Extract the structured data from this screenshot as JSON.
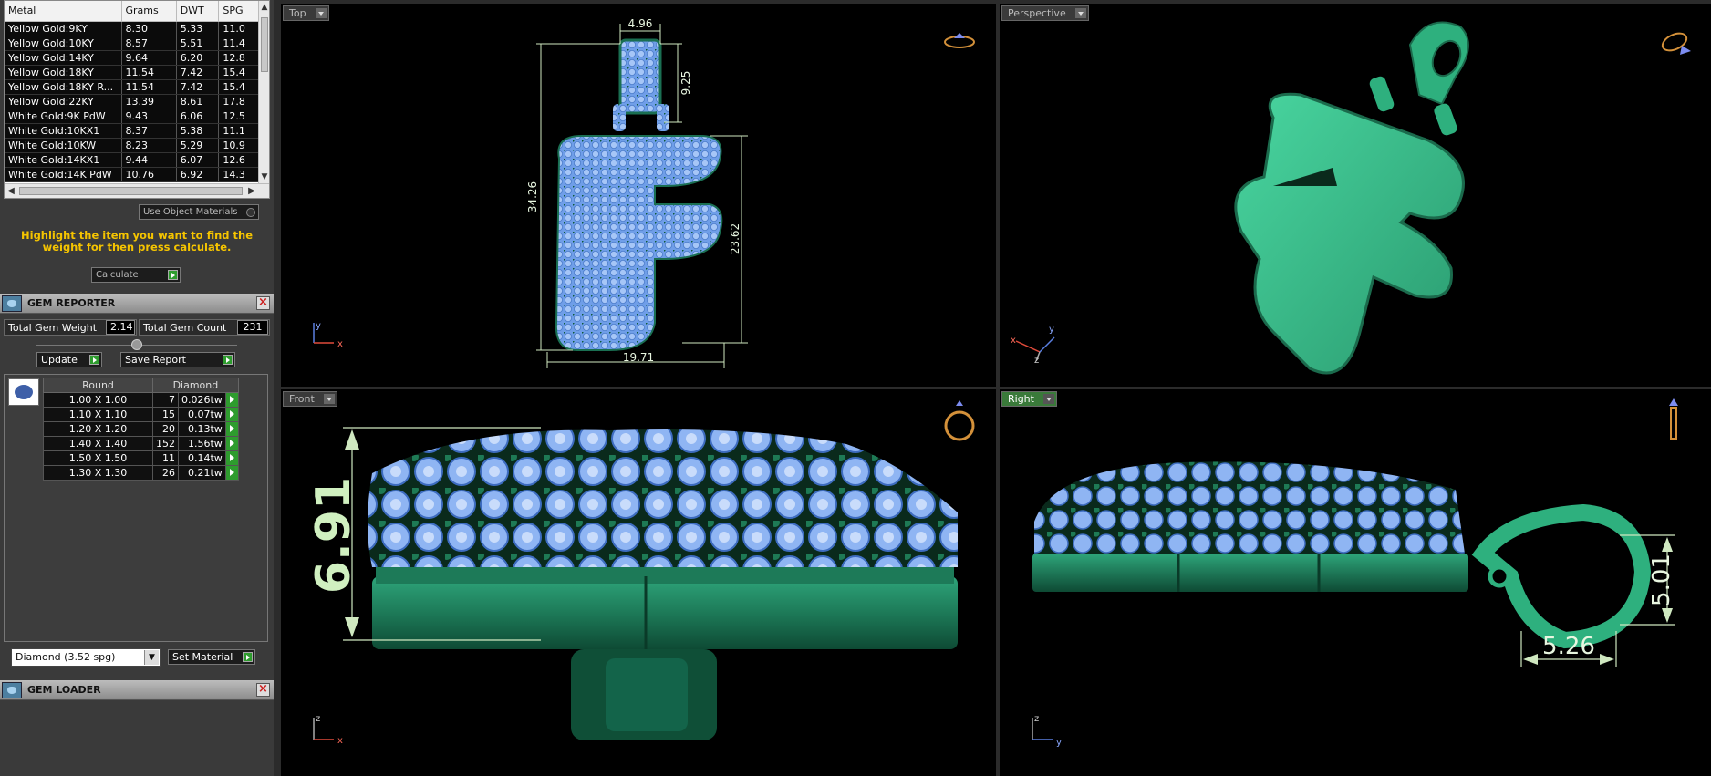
{
  "metal_table": {
    "columns": [
      "Metal",
      "Grams",
      "DWT",
      "SPG"
    ],
    "rows": [
      [
        "Yellow Gold:9KY",
        "8.30",
        "5.33",
        "11.0"
      ],
      [
        "Yellow Gold:10KY",
        "8.57",
        "5.51",
        "11.4"
      ],
      [
        "Yellow Gold:14KY",
        "9.64",
        "6.20",
        "12.8"
      ],
      [
        "Yellow Gold:18KY",
        "11.54",
        "7.42",
        "15.4"
      ],
      [
        "Yellow Gold:18KY R...",
        "11.54",
        "7.42",
        "15.4"
      ],
      [
        "Yellow Gold:22KY",
        "13.39",
        "8.61",
        "17.8"
      ],
      [
        "White Gold:9K PdW",
        "9.43",
        "6.06",
        "12.5"
      ],
      [
        "White Gold:10KX1",
        "8.37",
        "5.38",
        "11.1"
      ],
      [
        "White Gold:10KW",
        "8.23",
        "5.29",
        "10.9"
      ],
      [
        "White Gold:14KX1",
        "9.44",
        "6.07",
        "12.6"
      ],
      [
        "White Gold:14K PdW",
        "10.76",
        "6.92",
        "14.3"
      ]
    ]
  },
  "use_object_materials": "Use Object Materials",
  "hint_text": "Highlight the item you want to find the weight for then press calculate.",
  "calculate_label": "Calculate",
  "gem_reporter": {
    "title": "GEM REPORTER",
    "total_weight_label": "Total Gem Weight",
    "total_weight_value": "2.14",
    "total_count_label": "Total Gem Count",
    "total_count_value": "231",
    "update_label": "Update",
    "save_report_label": "Save Report",
    "table_headers": [
      "Round",
      "Diamond"
    ],
    "rows": [
      [
        "1.00 X 1.00",
        "7",
        "0.026tw"
      ],
      [
        "1.10 X 1.10",
        "15",
        "0.07tw"
      ],
      [
        "1.20 X 1.20",
        "20",
        "0.13tw"
      ],
      [
        "1.40 X 1.40",
        "152",
        "1.56tw"
      ],
      [
        "1.50 X 1.50",
        "11",
        "0.14tw"
      ],
      [
        "1.30 X 1.30",
        "26",
        "0.21tw"
      ]
    ],
    "material_select": "Diamond   (3.52 spg)",
    "set_material_label": "Set Material"
  },
  "gem_loader": {
    "title": "GEM LOADER"
  },
  "viewports": {
    "top": {
      "label": "Top",
      "dims": {
        "w_top": "4.96",
        "h_bail": "9.25",
        "h_total": "34.26",
        "h_body": "23.62",
        "w_total": "19.71"
      },
      "axes": {
        "a": "y",
        "b": "x"
      }
    },
    "perspective": {
      "label": "Perspective",
      "axes": {
        "a": "y",
        "b": "x",
        "c": "z"
      }
    },
    "front": {
      "label": "Front",
      "dims": {
        "height": "6.91"
      },
      "axes": {
        "a": "z",
        "b": "x"
      }
    },
    "right": {
      "label": "Right",
      "dims": {
        "bail_h": "5.01",
        "bail_w": "5.26"
      },
      "axes": {
        "a": "z",
        "b": "y"
      }
    }
  },
  "colors": {
    "metal": "#2fb888",
    "metal_dark": "#1a6f52",
    "gem": "#7fa9ef",
    "dim_line": "#cfe8c0",
    "dim_text_big": "#d0f0c0"
  }
}
